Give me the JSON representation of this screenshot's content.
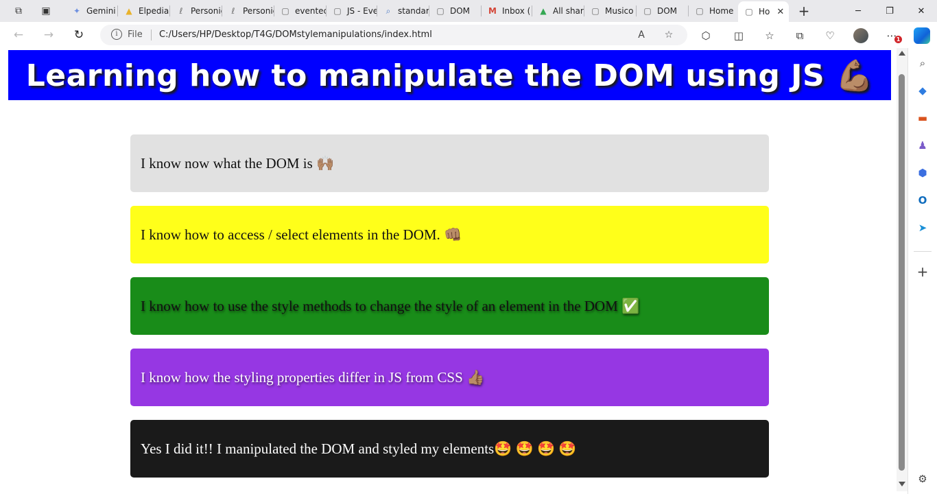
{
  "browser": {
    "tabs": [
      {
        "label": "Gemini",
        "icon": "gemini-icon",
        "glyph": "✦"
      },
      {
        "label": "Elpedia",
        "icon": "drive-icon",
        "glyph": "▲"
      },
      {
        "label": "Personic",
        "icon": "personio-icon",
        "glyph": "ℓ"
      },
      {
        "label": "Personic",
        "icon": "personio-icon",
        "glyph": "ℓ"
      },
      {
        "label": "eventec",
        "icon": "page-icon",
        "glyph": "▢"
      },
      {
        "label": "JS - Eve",
        "icon": "page-icon",
        "glyph": "▢"
      },
      {
        "label": "standar",
        "icon": "search-icon",
        "glyph": "⌕"
      },
      {
        "label": "DOM",
        "icon": "page-icon",
        "glyph": "▢"
      },
      {
        "label": "Inbox (",
        "icon": "gmail-icon",
        "glyph": "M"
      },
      {
        "label": "All shar",
        "icon": "drive-icon",
        "glyph": "▲"
      },
      {
        "label": "Musico",
        "icon": "page-icon",
        "glyph": "▢"
      },
      {
        "label": "DOM",
        "icon": "page-icon",
        "glyph": "▢"
      },
      {
        "label": "Home",
        "icon": "page-icon",
        "glyph": "▢"
      },
      {
        "label": "Ho",
        "icon": "page-icon",
        "glyph": "▢",
        "active": true
      }
    ],
    "address": {
      "scheme_label": "File",
      "url": "C:/Users/HP/Desktop/T4G/DOMstylemanipulations/index.html"
    }
  },
  "page": {
    "heading": "Learning how to manipulate the DOM using JS 💪🏽",
    "items": [
      {
        "text": "I know now what the DOM is 🙌🏽",
        "color": "#e1e1e1"
      },
      {
        "text": "I know how to access / select elements in the DOM. 👊🏽",
        "color": "#ffff1a"
      },
      {
        "text": "I know how to use the style methods to change the style of an element in the DOM ✅",
        "color": "#198c19"
      },
      {
        "text": "I know how the styling properties differ in JS from CSS 👍🏽",
        "color": "#9637e3"
      },
      {
        "text": "Yes I did it!! I manipulated the DOM and styled my elements🤩 🤩 🤩 🤩",
        "color": "#1a1a1a"
      }
    ],
    "banner_color": "#0000ff"
  },
  "sidebar": {
    "icons": [
      "search-icon",
      "tag-icon",
      "briefcase-icon",
      "games-icon",
      "copilot-icon",
      "outlook-icon",
      "send-icon",
      "add-icon",
      "settings-icon"
    ]
  },
  "badges": {
    "notification_count": "1"
  }
}
